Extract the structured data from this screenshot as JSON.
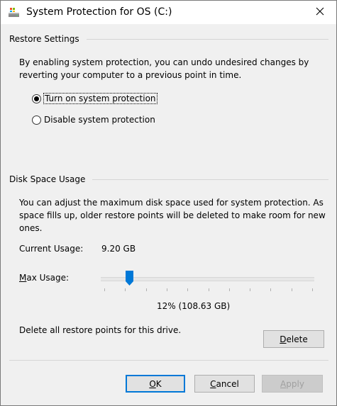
{
  "window": {
    "title": "System Protection for OS (C:)",
    "title_icon": "drive-icon",
    "close_glyph": "✕"
  },
  "restore": {
    "header": "Restore Settings",
    "description_line1": "By enabling system protection, you can undo undesired changes by",
    "description_line2": "reverting your computer to a previous point in time.",
    "options": [
      {
        "label": "Turn on system protection",
        "checked": true
      },
      {
        "label": "Disable system protection",
        "checked": false
      }
    ]
  },
  "disk": {
    "header": "Disk Space Usage",
    "description_line1": "You can adjust the maximum disk space used for system protection. As",
    "description_line2": "space fills up, older restore points will be deleted to make room for new",
    "description_line3": "ones.",
    "current_usage_label": "Current Usage:",
    "current_usage_value": "9.20 GB",
    "max_usage_label": "Max Usage:",
    "max_usage_fraction": 0.12,
    "max_usage_value": "12% (108.63 GB)",
    "delete_text": "Delete all restore points for this drive.",
    "delete_button": "Delete"
  },
  "buttons": {
    "ok": "OK",
    "cancel": "Cancel",
    "apply": "Apply"
  },
  "colors": {
    "accent": "#0078d7",
    "background": "#f0f0f0",
    "disabled_text": "#a0a0a0"
  }
}
